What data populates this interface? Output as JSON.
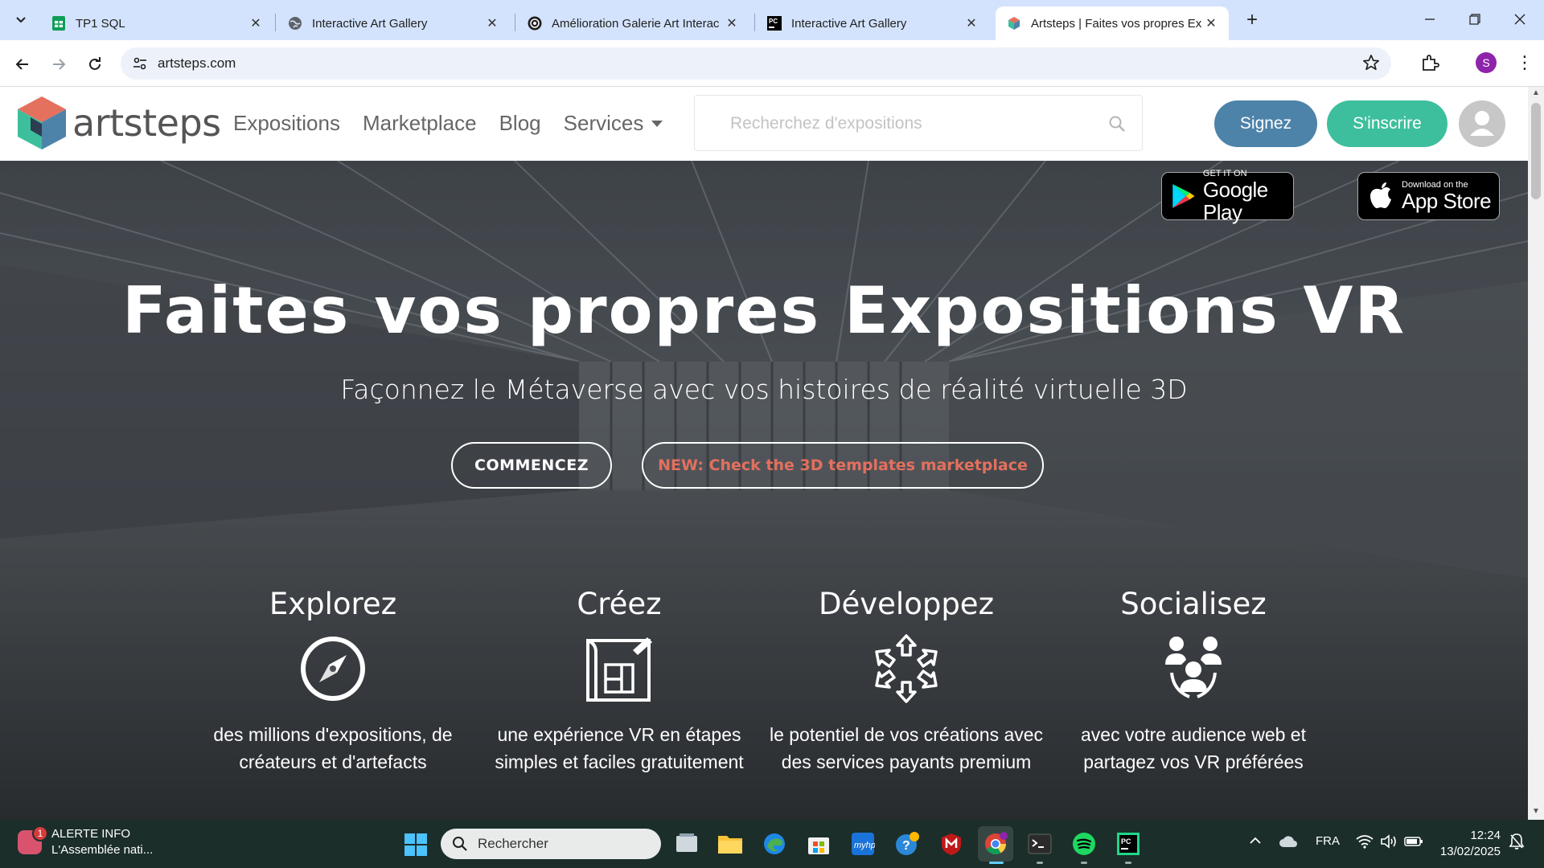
{
  "browser": {
    "tabs": [
      {
        "title": "TP1 SQL",
        "icon": "google-sheets-icon"
      },
      {
        "title": "Interactive Art Gallery",
        "icon": "globe-icon"
      },
      {
        "title": "Amélioration Galerie Art Interac",
        "icon": "chatgpt-icon"
      },
      {
        "title": "Interactive Art Gallery",
        "icon": "pycharm-icon"
      },
      {
        "title": "Artsteps | Faites vos propres Ex",
        "icon": "artsteps-icon",
        "active": true
      }
    ],
    "url": "artsteps.com",
    "profile_initial": "S"
  },
  "site": {
    "logo_text": "artsteps",
    "nav": [
      "Expositions",
      "Marketplace",
      "Blog",
      "Services"
    ],
    "search_placeholder": "Recherchez d'expositions",
    "signin_label": "Signez",
    "signup_label": "S'inscrire",
    "colors": {
      "signin": "#4e83a9",
      "signup": "#3dbf9d",
      "marketplace_link": "#e4705e"
    }
  },
  "hero": {
    "badges": {
      "google_small": "GET IT ON",
      "google_big": "Google Play",
      "apple_small": "Download on the",
      "apple_big": "App Store"
    },
    "title": "Faites vos propres Expositions VR",
    "subtitle": "Façonnez le Métaverse avec vos histoires de réalité virtuelle 3D",
    "cta_start": "COMMENCEZ",
    "cta_market": "NEW: Check the 3D templates marketplace",
    "features": [
      {
        "title": "Explorez",
        "icon": "compass-icon",
        "desc": "des millions d'expositions, de créateurs et d'artefacts"
      },
      {
        "title": "Créez",
        "icon": "blueprint-icon",
        "desc": "une expérience VR en étapes simples et faciles gratuitement"
      },
      {
        "title": "Développez",
        "icon": "expand-arrows-icon",
        "desc": "le potentiel de vos créations avec des services payants premium"
      },
      {
        "title": "Socialisez",
        "icon": "community-icon",
        "desc": "avec votre audience web et partagez vos VR préférées"
      }
    ]
  },
  "taskbar": {
    "news_title": "ALERTE INFO",
    "news_text": "L'Assemblée nati...",
    "news_badge": "1",
    "search_placeholder": "Rechercher",
    "language": "FRA",
    "time": "12:24",
    "date": "13/02/2025"
  }
}
